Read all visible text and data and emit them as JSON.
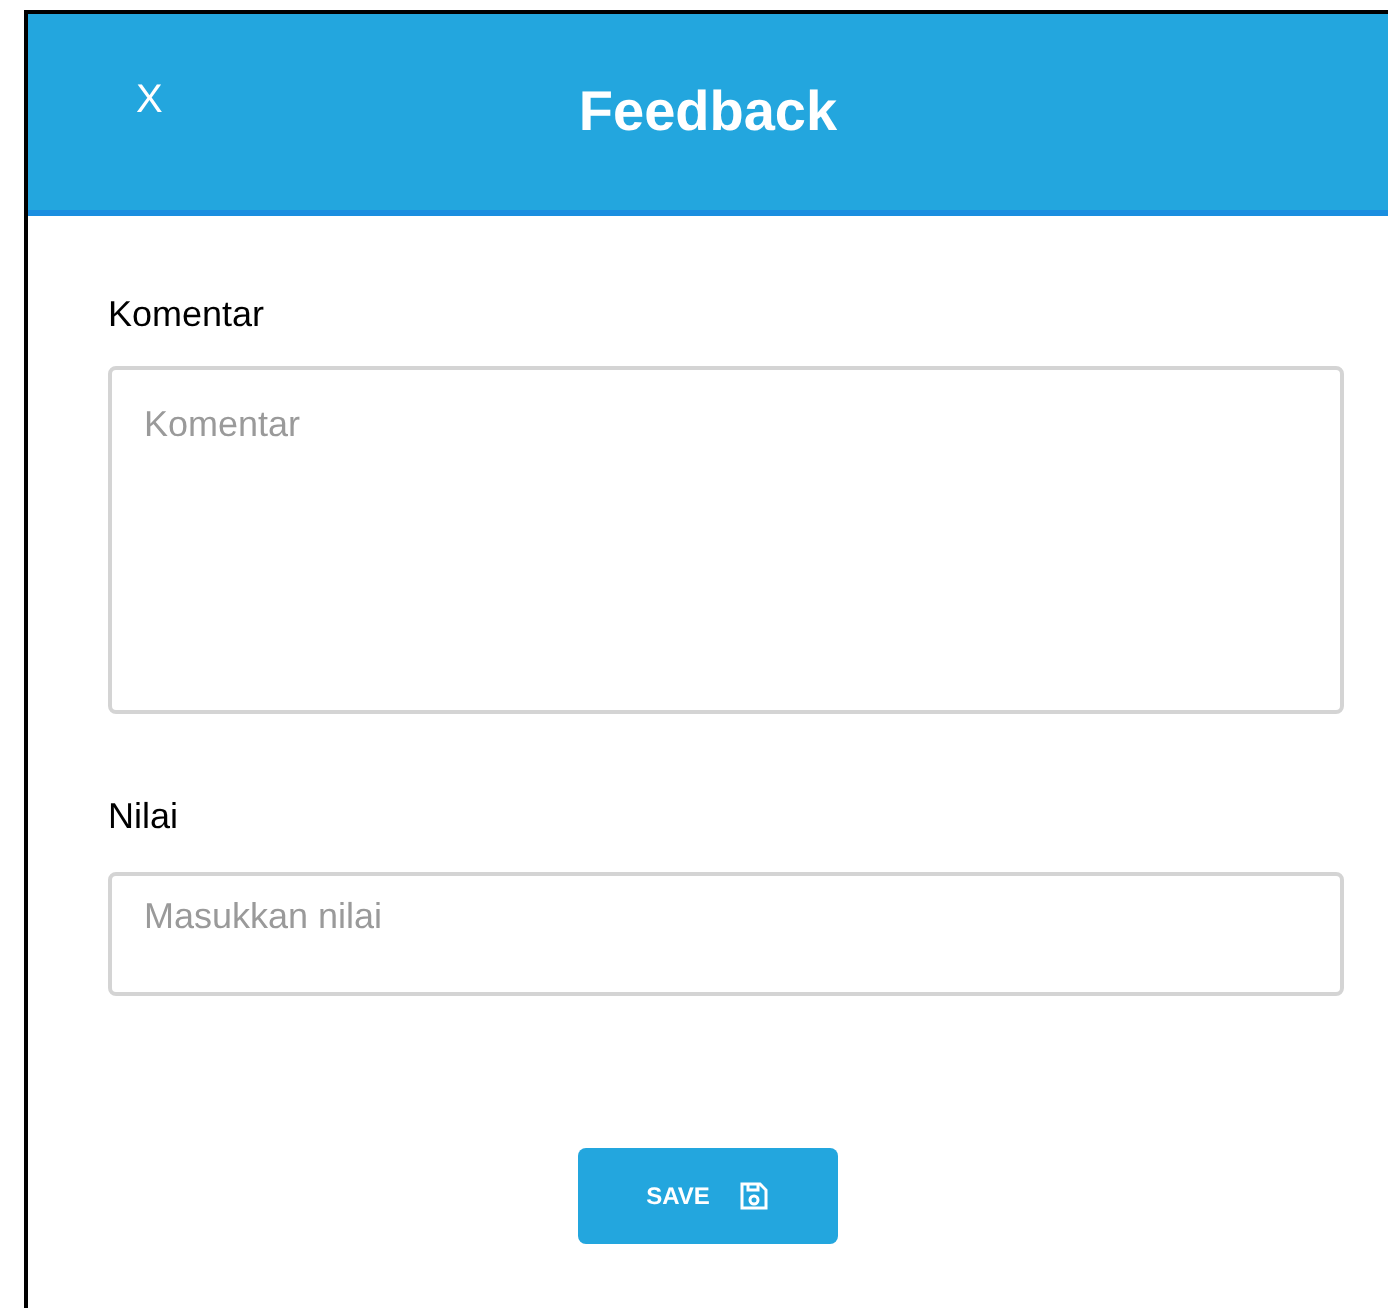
{
  "dialog": {
    "close": "X",
    "title": "Feedback"
  },
  "fields": [
    {
      "kind": "textarea",
      "label": "Komentar",
      "placeholder": "Komentar"
    },
    {
      "kind": "input",
      "label": "Nilai",
      "placeholder": "Masukkan nilai"
    }
  ],
  "save_button": "SAVE"
}
